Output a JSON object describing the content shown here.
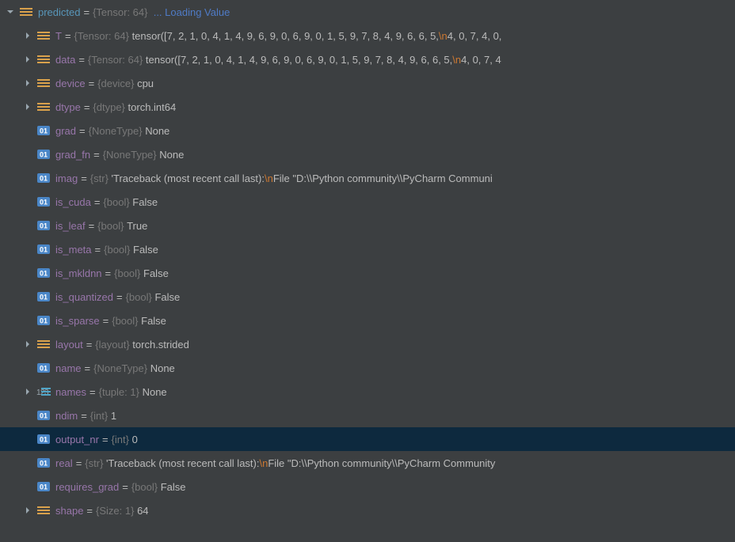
{
  "root": {
    "name": "predicted",
    "type": "{Tensor: 64}",
    "loading": "... Loading Value"
  },
  "rows": [
    {
      "id": "t",
      "name": "T",
      "type": "{Tensor: 64}",
      "expandable": true,
      "icon": "struct",
      "value": "tensor([7, 2, 1, 0, 4, 1, 4, 9, 6, 9, 0, 6, 9, 0, 1, 5, 9, 7, 8, 4, 9, 6, 6, 5,",
      "nl": "\\n",
      "tail": "        4, 0, 7, 4, 0,"
    },
    {
      "id": "data",
      "name": "data",
      "type": "{Tensor: 64}",
      "expandable": true,
      "icon": "struct",
      "value": "tensor([7, 2, 1, 0, 4, 1, 4, 9, 6, 9, 0, 6, 9, 0, 1, 5, 9, 7, 8, 4, 9, 6, 6, 5,",
      "nl": "\\n",
      "tail": "        4, 0, 7, 4"
    },
    {
      "id": "device",
      "name": "device",
      "type": "{device}",
      "expandable": true,
      "icon": "struct",
      "value": "cpu"
    },
    {
      "id": "dtype",
      "name": "dtype",
      "type": "{dtype}",
      "expandable": true,
      "icon": "struct",
      "value": "torch.int64"
    },
    {
      "id": "grad",
      "name": "grad",
      "type": "{NoneType}",
      "expandable": false,
      "icon": "prim",
      "value": "None"
    },
    {
      "id": "grad_fn",
      "name": "grad_fn",
      "type": "{NoneType}",
      "expandable": false,
      "icon": "prim",
      "value": "None"
    },
    {
      "id": "imag",
      "name": "imag",
      "type": "{str}",
      "expandable": false,
      "icon": "prim",
      "value": "'Traceback (most recent call last):",
      "nl": "\\n",
      "tail": "  File \"D:\\\\Python community\\\\PyCharm Communi"
    },
    {
      "id": "is_cuda",
      "name": "is_cuda",
      "type": "{bool}",
      "expandable": false,
      "icon": "prim",
      "value": "False"
    },
    {
      "id": "is_leaf",
      "name": "is_leaf",
      "type": "{bool}",
      "expandable": false,
      "icon": "prim",
      "value": "True"
    },
    {
      "id": "is_meta",
      "name": "is_meta",
      "type": "{bool}",
      "expandable": false,
      "icon": "prim",
      "value": "False"
    },
    {
      "id": "is_mkldnn",
      "name": "is_mkldnn",
      "type": "{bool}",
      "expandable": false,
      "icon": "prim",
      "value": "False"
    },
    {
      "id": "is_quant",
      "name": "is_quantized",
      "type": "{bool}",
      "expandable": false,
      "icon": "prim",
      "value": "False"
    },
    {
      "id": "is_sparse",
      "name": "is_sparse",
      "type": "{bool}",
      "expandable": false,
      "icon": "prim",
      "value": "False"
    },
    {
      "id": "layout",
      "name": "layout",
      "type": "{layout}",
      "expandable": true,
      "icon": "struct",
      "value": "torch.strided"
    },
    {
      "id": "nm",
      "name": "name",
      "type": "{NoneType}",
      "expandable": false,
      "icon": "prim",
      "value": "None"
    },
    {
      "id": "names",
      "name": "names",
      "type": "{tuple: 1}",
      "expandable": true,
      "icon": "tuple",
      "value": "None"
    },
    {
      "id": "ndim",
      "name": "ndim",
      "type": "{int}",
      "expandable": false,
      "icon": "prim",
      "value": "1"
    },
    {
      "id": "output_nr",
      "name": "output_nr",
      "type": "{int}",
      "expandable": false,
      "icon": "prim",
      "value": "0",
      "selected": true
    },
    {
      "id": "real",
      "name": "real",
      "type": "{str}",
      "expandable": false,
      "icon": "prim",
      "value": "'Traceback (most recent call last):",
      "nl": "\\n",
      "tail": "  File \"D:\\\\Python community\\\\PyCharm Community"
    },
    {
      "id": "req_grad",
      "name": "requires_grad",
      "type": "{bool}",
      "expandable": false,
      "icon": "prim",
      "value": "False"
    },
    {
      "id": "shape",
      "name": "shape",
      "type": "{Size: 1}",
      "expandable": true,
      "icon": "struct",
      "value": "64"
    }
  ]
}
